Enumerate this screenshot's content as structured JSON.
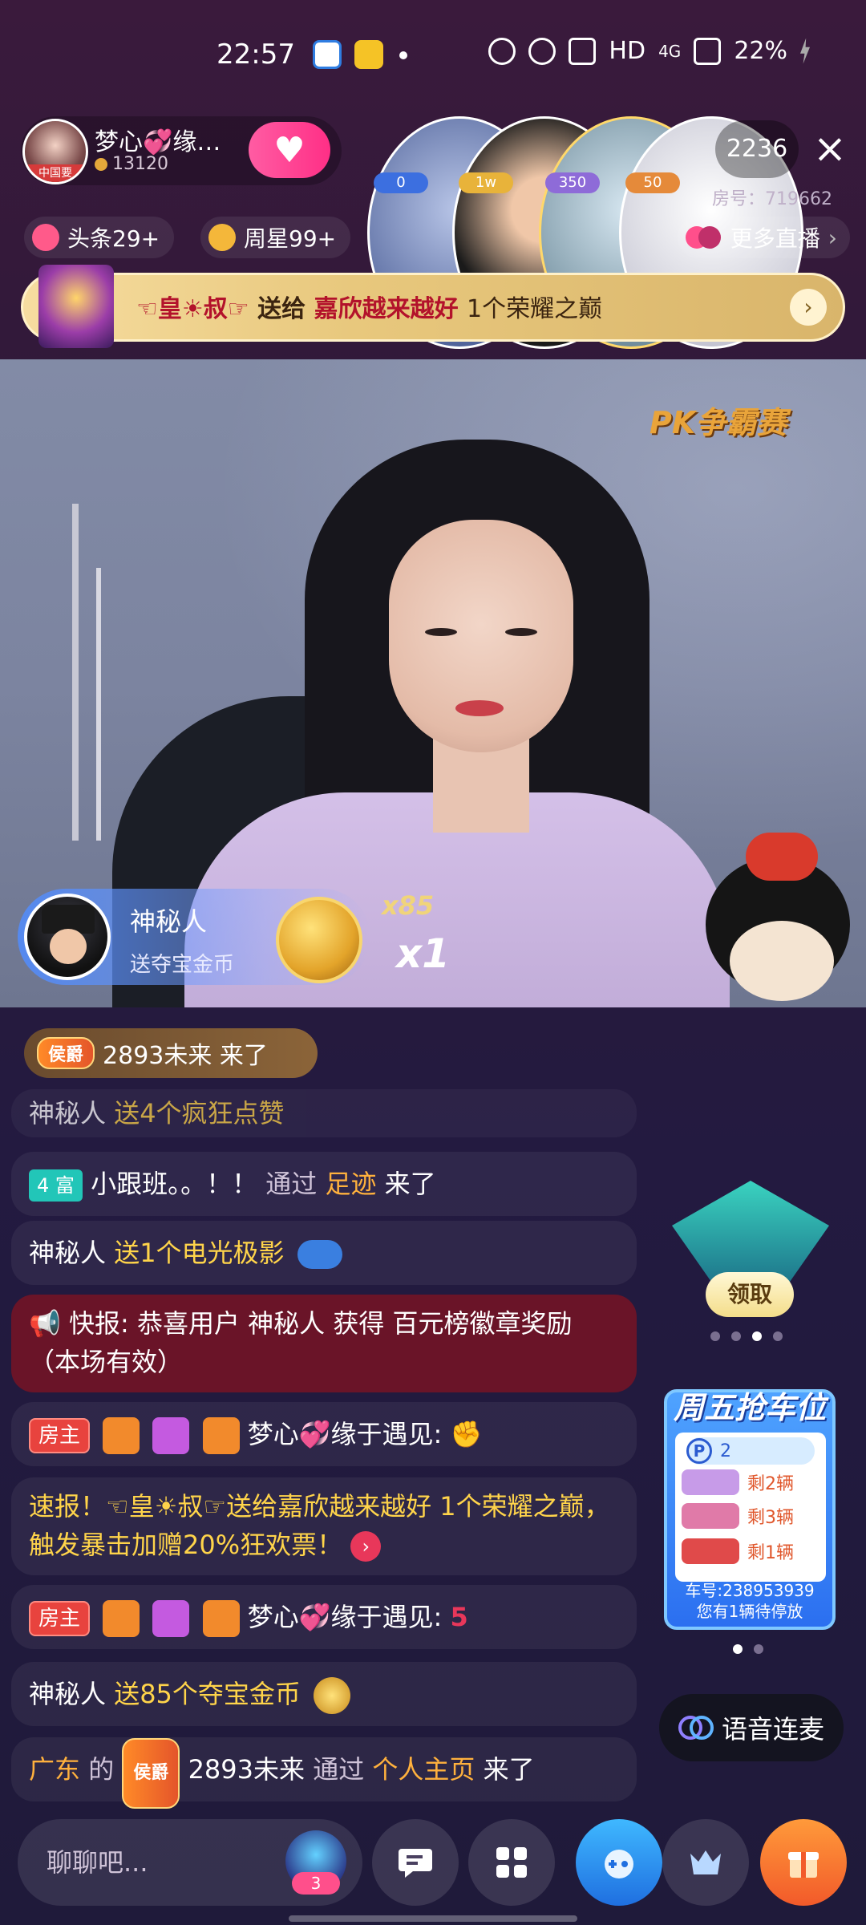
{
  "status_bar": {
    "time": "22:57",
    "network": "HD",
    "signal": "4G",
    "battery": "22%"
  },
  "host": {
    "name": "梦心💞缘…",
    "avatar_tag": "中国要",
    "coins": "13120"
  },
  "viewers": [
    {
      "badge": "0",
      "badge_color": "#3c6fe0",
      "ring": "#7ea6ff"
    },
    {
      "badge": "1w",
      "badge_color": "#e8b33a",
      "ring": "#ffffff"
    },
    {
      "badge": "350",
      "badge_color": "#8e6bd8",
      "ring": "#ffd86a"
    },
    {
      "badge": "50",
      "badge_color": "#e58a3a",
      "ring": "#ffffff"
    }
  ],
  "online_count": "2236",
  "room_number": "房号：719662",
  "chips": {
    "headline": "头条29+",
    "weekly_star": "周星99+",
    "more_live": "更多直播"
  },
  "banner": {
    "sender": "☜皇☀叔☞",
    "verb": "送给",
    "receiver": "嘉欣越来越好",
    "gift": "1个荣耀之巅",
    "arrow": "›"
  },
  "video": {
    "pk_logo": "PK争霸赛"
  },
  "gift_popup": {
    "user": "神秘人",
    "action": "送夺宝金币",
    "total": "x85",
    "combo": "x1"
  },
  "entry_banner": {
    "rank": "侯爵",
    "text": "2893未来 来了"
  },
  "chat": {
    "m0": {
      "user": "神秘人",
      "text": "送4个疯狂点赞"
    },
    "m1": {
      "level": "4 富",
      "user": "小跟班。。！！",
      "via": "通过",
      "source": "足迹",
      "tail": "来了"
    },
    "m2": {
      "user": "神秘人",
      "text": "送1个电光极影"
    },
    "m3": {
      "text": "📢 快报: 恭喜用户 神秘人 获得 百元榜徽章奖励（本场有效）"
    },
    "m4": {
      "tag": "房主",
      "user": "梦心💞缘于遇见:",
      "emoji": "✊"
    },
    "m5": {
      "text": "速报！☜皇☀叔☞送给嘉欣越来越好 1个荣耀之巅，触发暴击加赠20%狂欢票！",
      "go": "›"
    },
    "m6": {
      "tag": "房主",
      "user": "梦心💞缘于遇见:",
      "emoji": "5"
    },
    "m7": {
      "user": "神秘人",
      "text": "送85个夺宝金币"
    },
    "m8": {
      "region": "广东",
      "of": "的",
      "rank": "侯爵",
      "user": "2893未来",
      "via": "通过",
      "source": "个人主页",
      "tail": "来了"
    }
  },
  "side": {
    "claim": "领取",
    "car_title": "周五抢车位",
    "park_value": "2",
    "cars": [
      "剩2辆",
      "剩3辆",
      "剩1辆"
    ],
    "car_no": "车号:238953939",
    "car_wait": "您有1辆待停放",
    "voice": "语音连麦"
  },
  "bottom": {
    "placeholder": "聊聊吧...",
    "badge_count": "3"
  }
}
